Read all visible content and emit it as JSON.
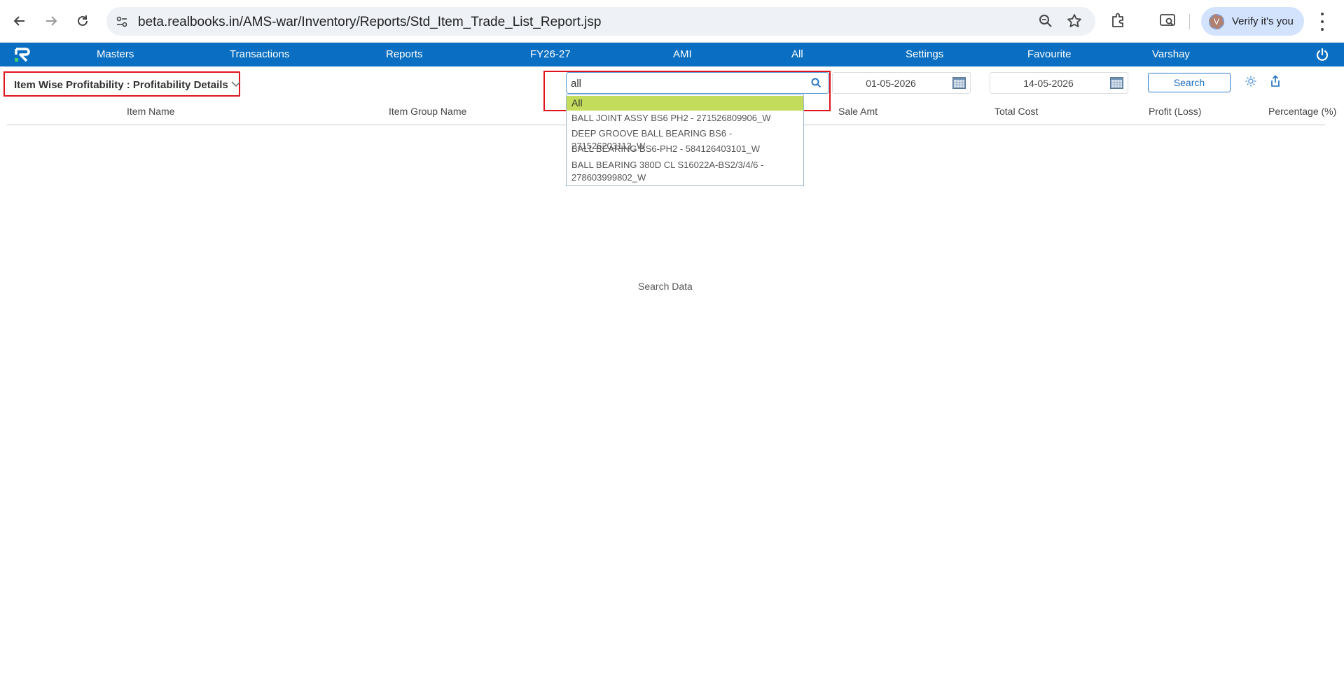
{
  "browser": {
    "url": "beta.realbooks.in/AMS-war/Inventory/Reports/Std_Item_Trade_List_Report.jsp",
    "profile_label": "Verify it's you",
    "profile_initial": "V"
  },
  "nav": {
    "items": [
      "Masters",
      "Transactions",
      "Reports",
      "FY26-27",
      "AMI",
      "All",
      "Settings",
      "Favourite",
      "Varshay"
    ]
  },
  "report": {
    "title": "Item Wise Profitability : Profitability Details"
  },
  "filters": {
    "search_value": "all",
    "from_date": "01-05-2026",
    "to_date": "14-05-2026",
    "search_button": "Search"
  },
  "dropdown": {
    "options": [
      "All",
      "BALL JOINT ASSY BS6 PH2 - 271526809906_W",
      "DEEP GROOVE BALL BEARING BS6 - 271526203113_W",
      "BALL BEARING BS6-PH2 - 584126403101_W",
      "BALL BEARING 380D CL S16022A-BS2/3/4/6 - 278603999802_W"
    ],
    "selected_index": 0
  },
  "table": {
    "headers": [
      "Item Name",
      "Item Group Name",
      "Sale Amt",
      "Total Cost",
      "Profit (Loss)",
      "Percentage (%)"
    ],
    "empty_message": "Search Data"
  },
  "colors": {
    "nav_bg": "#0a6fc2",
    "highlight": "#e0141c",
    "selected_option": "#c4dc5c"
  }
}
